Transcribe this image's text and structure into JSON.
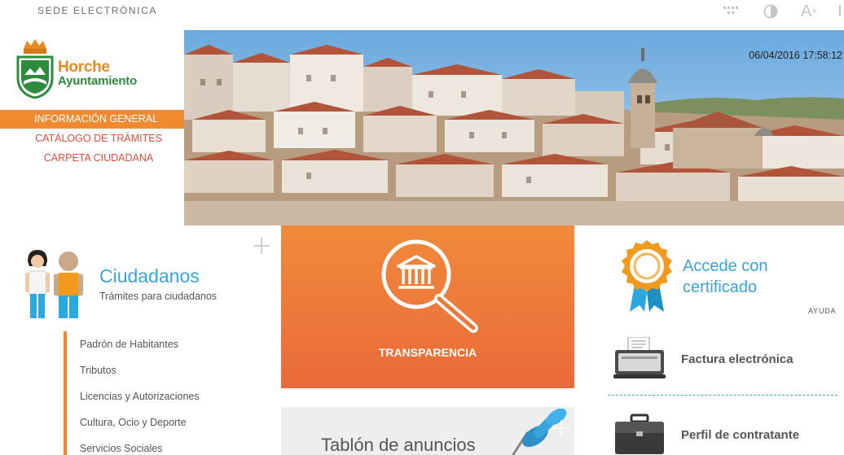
{
  "header": {
    "site_label": "SEDE ELECTRÓNICA",
    "icons": [
      "grid-icon",
      "contrast-icon",
      "font-size-icon"
    ]
  },
  "logo": {
    "name": "Horche",
    "subtitle": "Ayuntamiento"
  },
  "nav": {
    "items": [
      {
        "label": "INFORMACIÓN GENERAL",
        "active": true
      },
      {
        "label": "CATÁLOGO DE TRÁMITES",
        "active": false
      },
      {
        "label": "CARPETA CIUDADANA",
        "active": false
      }
    ]
  },
  "hero": {
    "timestamp": "06/04/2016 17:58:12"
  },
  "ciudadanos": {
    "title": "Ciudadanos",
    "subtitle": "Trámites para ciudadanos",
    "items": [
      "Padrón de Habitantes",
      "Tributos",
      "Licencias y Autorizaciones",
      "Cultura, Ocio y Deporte",
      "Servicios Sociales"
    ]
  },
  "transparencia": {
    "label": "TRANSPARENCIA"
  },
  "tablon": {
    "label": "Tablón de anuncios"
  },
  "certificado": {
    "title": "Accede con certificado",
    "help": "AYUDA"
  },
  "links": {
    "factura": "Factura electrónica",
    "perfil": "Perfil de contratante"
  },
  "colors": {
    "orange": "#f08a30",
    "red_text": "#e14e3b",
    "blue": "#3aa3dc",
    "green": "#2d8c3c"
  }
}
